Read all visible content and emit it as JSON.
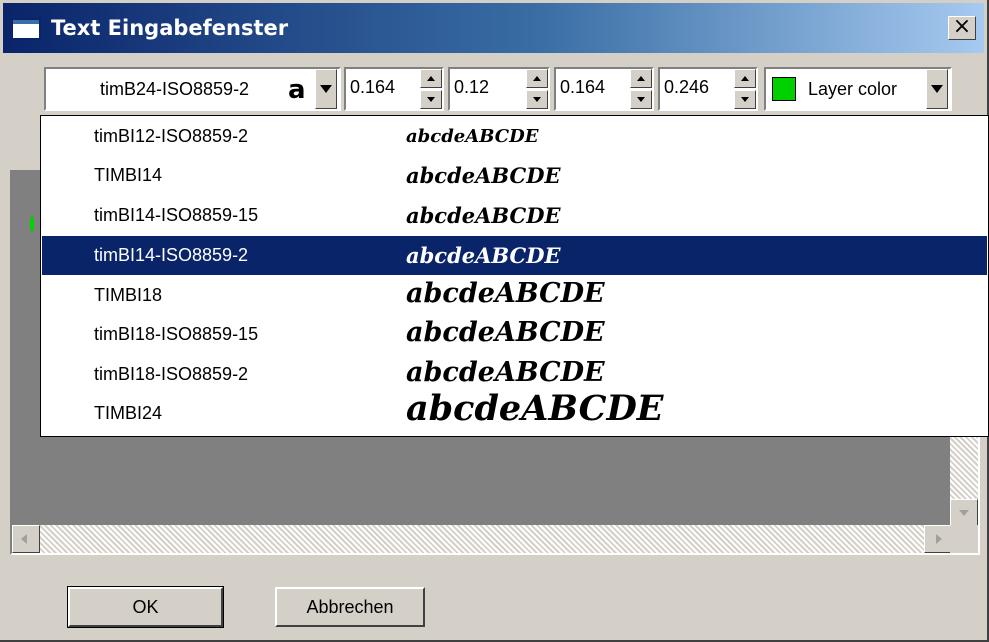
{
  "window": {
    "title": "Text Eingabefenster",
    "close_label": "×"
  },
  "toolbar": {
    "font": {
      "value": "timB24-ISO8859-2",
      "glyph": "a"
    },
    "spinners": [
      {
        "value": "0.164"
      },
      {
        "value": "0.12"
      },
      {
        "value": "0.164"
      },
      {
        "value": "0.246"
      }
    ],
    "color": {
      "swatch": "#00d000",
      "label": "Layer color"
    }
  },
  "font_list": {
    "sample_text": "abcdeABCDE",
    "selected_index": 3,
    "items": [
      {
        "name": "timBI12-ISO8859-2"
      },
      {
        "name": "TIMBI14"
      },
      {
        "name": "timBI14-ISO8859-15"
      },
      {
        "name": "timBI14-ISO8859-2"
      },
      {
        "name": "TIMBI18"
      },
      {
        "name": "timBI18-ISO8859-15"
      },
      {
        "name": "timBI18-ISO8859-2"
      },
      {
        "name": "TIMBI24"
      }
    ]
  },
  "buttons": {
    "ok": "OK",
    "cancel": "Abbrechen"
  },
  "colors": {
    "title_active": "#0a246a",
    "selection": "#0a246a",
    "face": "#d4d0c8",
    "layer_color": "#00d000"
  }
}
